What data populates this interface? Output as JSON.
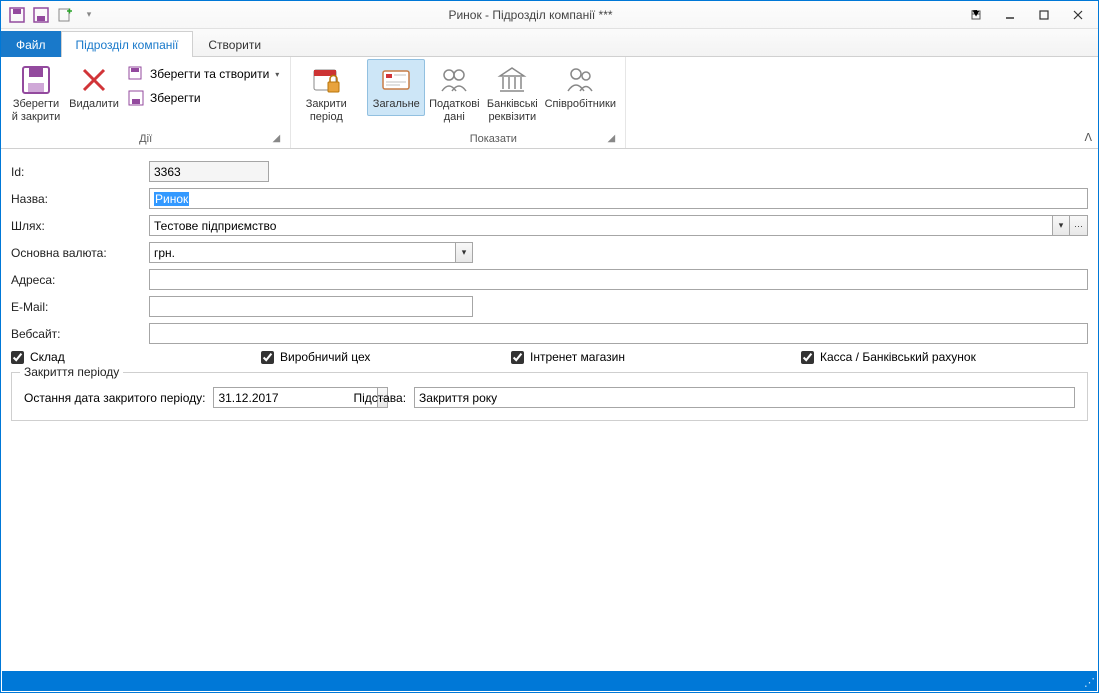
{
  "window": {
    "title": "Ринок - Підрозділ компанії ***"
  },
  "tabs": {
    "file": "Файл",
    "division": "Підрозділ компанії",
    "create": "Створити"
  },
  "ribbon": {
    "actions": {
      "label": "Дії",
      "save_close": "Зберегти й закрити",
      "delete": "Видалити",
      "save_and_create": "Зберегти та створити",
      "save": "Зберегти",
      "close_period": "Закрити період"
    },
    "show": {
      "label": "Показати",
      "general": "Загальне",
      "tax": "Податкові дані",
      "bank": "Банківські реквізити",
      "employees": "Співробітники"
    }
  },
  "form": {
    "id_label": "Id:",
    "id_value": "3363",
    "name_label": "Назва:",
    "name_value": "Ринок",
    "path_label": "Шлях:",
    "path_value": "Тестове підприємство",
    "currency_label": "Основна валюта:",
    "currency_value": "грн.",
    "address_label": "Адреса:",
    "address_value": "",
    "email_label": "E-Mail:",
    "email_value": "",
    "website_label": "Вебсайт:",
    "website_value": ""
  },
  "checks": {
    "warehouse": "Склад",
    "workshop": "Виробничий цех",
    "eshop": "Інтренет магазин",
    "cash": "Касса / Банківський рахунок"
  },
  "period": {
    "legend": "Закриття періоду",
    "last_date_label": "Остання дата закритого періоду:",
    "last_date_value": "31.12.2017",
    "reason_label": "Підстава:",
    "reason_value": "Закриття року"
  }
}
